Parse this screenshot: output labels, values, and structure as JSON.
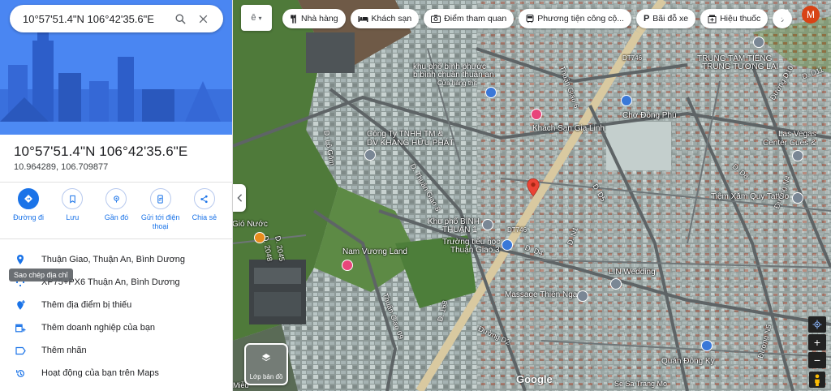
{
  "search": {
    "value": "10°57'51.4\"N 106°42'35.6\"E",
    "search_icon": "search-icon",
    "close_icon": "close-icon"
  },
  "place": {
    "title": "10°57'51.4\"N 106°42'35.6\"E",
    "decimal": "10.964289, 106.709877"
  },
  "actions": [
    {
      "label": "Đường đi",
      "icon": "directions-icon"
    },
    {
      "label": "Lưu",
      "icon": "bookmark-icon"
    },
    {
      "label": "Gần đó",
      "icon": "nearby-icon"
    },
    {
      "label": "Gửi tới điện thoại",
      "icon": "send-to-phone-icon"
    },
    {
      "label": "Chia sẻ",
      "icon": "share-icon"
    }
  ],
  "info": [
    {
      "text": "Thuận Giao, Thuận An, Bình Dương",
      "icon": "location-pin-icon"
    },
    {
      "text": "XP75+PX6 Thuận An, Bình Dương",
      "icon": "plus-code-icon"
    },
    {
      "text": "Thêm địa điểm bị thiếu",
      "icon": "add-place-icon"
    },
    {
      "text": "Thêm doanh nghiệp của bạn",
      "icon": "add-business-icon"
    },
    {
      "text": "Thêm nhãn",
      "icon": "label-icon"
    },
    {
      "text": "Hoạt động của bạn trên Maps",
      "icon": "history-icon"
    }
  ],
  "tooltip": "Sao chép địa chỉ",
  "chips": [
    {
      "label": "Nhà hàng",
      "icon": "restaurant-icon"
    },
    {
      "label": "Khách sạn",
      "icon": "hotel-icon"
    },
    {
      "label": "Điểm tham quan",
      "icon": "camera-icon"
    },
    {
      "label": "Phương tiện công cộ...",
      "icon": "transit-icon"
    },
    {
      "label": "Bãi đỗ xe",
      "icon": "parking-icon"
    },
    {
      "label": "Hiệu thuốc",
      "icon": "pharmacy-icon"
    }
  ],
  "user": {
    "initial": "M"
  },
  "layers": {
    "label": "Lớp bản đồ"
  },
  "brand": "Google",
  "map_labels": [
    "khu phố bình phước",
    "b bình chuẩn thuận an",
    "Cửa hàng thịt",
    "Công Ty TNHH TM &",
    "DV KHANG HỮU PHÁT",
    "Khách Sạn Gia Linh",
    "Chợ Đông Phú",
    "TRUNG TÂM TIẾNG",
    "TRUNG TƯƠNG LAI",
    "Las Vegas",
    "Center Cues &",
    "Tiệm Xăm Quy Tattoo",
    "Khu phố BÌNH",
    "THUẬN 1",
    "Trường tiểu học",
    "Thuận Giao 3",
    "Nam Vương Land",
    "LIN Wedding",
    "Massage Thiên Nga 3",
    "Quán Đông Kỳ",
    "Gió Nước",
    "DT746",
    "Thuận Giao 6",
    "Đường D10",
    "Đường D2",
    "Đường N4",
    "Thuận Giao 09",
    "D. Lô Gốm",
    "D. Thuận Giao 8",
    "D. 168",
    "D. D4",
    "D. D5",
    "D. D8",
    "D. N1",
    "D. D11",
    "Đường N5",
    "D. 2048",
    "D. 2045",
    "Miễu",
    "Se Sa Trang Mo"
  ]
}
